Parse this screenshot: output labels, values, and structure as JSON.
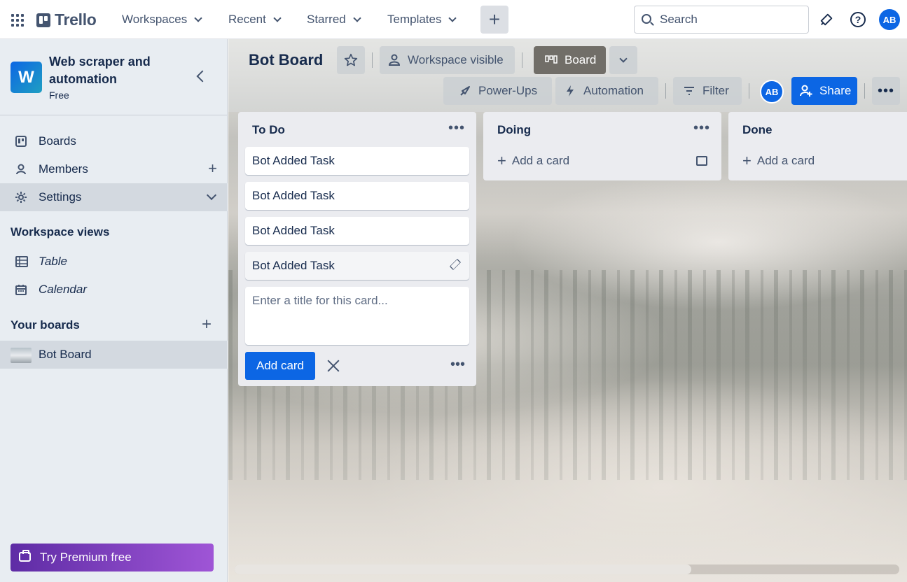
{
  "topnav": {
    "logo_text": "Trello",
    "menus": [
      "Workspaces",
      "Recent",
      "Starred",
      "Templates"
    ],
    "search_placeholder": "Search",
    "avatar_initials": "AB",
    "help_glyph": "?"
  },
  "sidebar": {
    "workspace_initial": "W",
    "workspace_name": "Web scraper and automation",
    "workspace_plan": "Free",
    "items": [
      {
        "label": "Boards",
        "icon": "board-icon"
      },
      {
        "label": "Members",
        "icon": "members-icon"
      },
      {
        "label": "Settings",
        "icon": "gear-icon"
      }
    ],
    "workspace_views_title": "Workspace views",
    "views": [
      {
        "label": "Table",
        "icon": "table-icon"
      },
      {
        "label": "Calendar",
        "icon": "calendar-icon"
      }
    ],
    "your_boards_title": "Your boards",
    "boards": [
      {
        "label": "Bot Board"
      }
    ],
    "premium_label": "Try Premium free"
  },
  "board": {
    "title": "Bot Board",
    "visibility_label": "Workspace visible",
    "view_label": "Board",
    "powerups_label": "Power-Ups",
    "automation_label": "Automation",
    "filter_label": "Filter",
    "member_initials": "AB",
    "share_label": "Share",
    "background_colors": {
      "accent": "#0c66e4",
      "view_active": "#716e68"
    }
  },
  "lists": [
    {
      "title": "To Do",
      "cards": [
        "Bot Added Task",
        "Bot Added Task",
        "Bot Added Task",
        "Bot Added Task"
      ],
      "composer_placeholder": "Enter a title for this card...",
      "add_button_label": "Add card"
    },
    {
      "title": "Doing",
      "add_label": "Add a card"
    },
    {
      "title": "Done",
      "add_label": "Add a card"
    }
  ]
}
